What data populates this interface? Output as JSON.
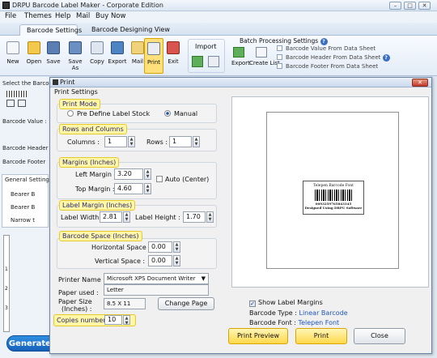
{
  "window": {
    "title": "DRPU Barcode Label Maker - Corporate Edition"
  },
  "menu": [
    "File",
    "Themes",
    "Help",
    "Mail",
    "Buy Now"
  ],
  "tabs": [
    "Barcode Settings",
    "Barcode Designing View"
  ],
  "ribbon": {
    "buttons": [
      "New",
      "Open",
      "Save",
      "Save As",
      "Copy",
      "Export",
      "Mail",
      "Print",
      "Exit"
    ],
    "import_label": "Import",
    "batch": {
      "title": "Batch Processing Settings",
      "export_label": "Export",
      "create_list_label": "Create List",
      "options": [
        "Barcode Value From Data Sheet",
        "Barcode Header From Data Sheet",
        "Barcode Footer From Data Sheet"
      ]
    }
  },
  "left_panel": {
    "select_label": "Select the Barcod",
    "value_label": "Barcode Value :",
    "header_label": "Barcode Header",
    "footer_label": "Barcode Footer",
    "general_label": "General Settings",
    "bearer1": "Bearer B",
    "bearer2": "Bearer B",
    "narrow": "Narrow t",
    "ruler_marks": [
      "1",
      "2",
      "3"
    ]
  },
  "banner": "Generate-Barcode.com",
  "dialog": {
    "title": "Print",
    "settings_label": "Print Settings",
    "print_mode": {
      "label": "Print Mode",
      "option1": "Pre Define Label Stock",
      "option2": "Manual",
      "selected": "Manual"
    },
    "rows_cols": {
      "label": "Rows and Columns",
      "columns_label": "Columns :",
      "columns": "1",
      "rows_label": "Rows :",
      "rows": "1"
    },
    "margins": {
      "label": "Margins (Inches)",
      "left_label": "Left Margin :",
      "left": "3.20",
      "top_label": "Top Margin :",
      "top": "4.60",
      "auto_label": "Auto (Center)"
    },
    "label_margin": {
      "label": "Label Margin (Inches)",
      "width_label": "Label Width :",
      "width": "2.81",
      "height_label": "Label Height :",
      "height": "1.70"
    },
    "barcode_space": {
      "label": "Barcode Space (Inches)",
      "h_label": "Horizontal Space :",
      "h": "0.00",
      "v_label": "Vertical Space :",
      "v": "0.00"
    },
    "printer_name_label": "Printer Name :",
    "printer_name": "Microsoft XPS Document Writer",
    "paper_used_label": "Paper used :",
    "paper_used": "Letter",
    "paper_size_label": "Paper Size",
    "paper_size_unit": "(Inches) :",
    "paper_size": "8.5 X 11",
    "change_page": "Change Page",
    "copies_label": "Copies number :",
    "copies": "10",
    "show_margins": "Show Label Margins",
    "barcode_type_label": "Barcode Type :",
    "barcode_type": "Linear Barcode",
    "barcode_font_label": "Barcode Font :",
    "barcode_font": "Telepen Font",
    "preview_label": {
      "title": "Telepen Barcode Font",
      "number": "0093259765843345",
      "footer": "Designed Using DRPU Software"
    },
    "buttons": {
      "preview": "Print Preview",
      "print": "Print",
      "close": "Close"
    }
  },
  "colors": {
    "accent": "#ffd84a",
    "title_blue": "#1f57b8",
    "banner": "#1660b8"
  }
}
